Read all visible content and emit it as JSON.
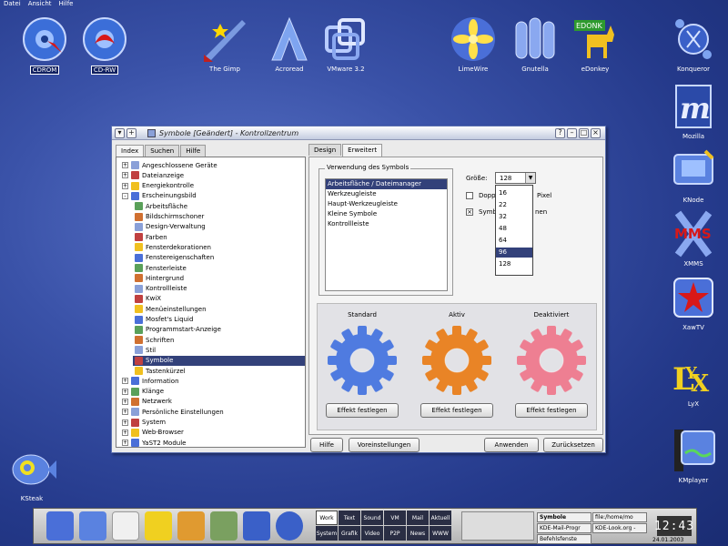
{
  "menubar": [
    "Datei",
    "Ansicht",
    "Hilfe"
  ],
  "desktop_icons": [
    {
      "label": "CDROM",
      "selected": true
    },
    {
      "label": "CD-RW",
      "selected": true
    },
    {
      "label": "The Gimp",
      "selected": false
    },
    {
      "label": "Acroread",
      "selected": false
    },
    {
      "label": "VMware 3.2",
      "selected": false
    },
    {
      "label": "LimeWire",
      "selected": false
    },
    {
      "label": "Gnutella",
      "selected": false
    },
    {
      "label": "eDonkey",
      "selected": false
    },
    {
      "label": "Konqueror",
      "selected": false
    },
    {
      "label": "Mozilla",
      "selected": false
    },
    {
      "label": "KNode",
      "selected": false
    },
    {
      "label": "XMMS",
      "selected": false
    },
    {
      "label": "XawTV",
      "selected": false
    },
    {
      "label": "LyX",
      "selected": false
    },
    {
      "label": "KMplayer",
      "selected": false
    },
    {
      "label": "KSteak",
      "selected": false
    }
  ],
  "window": {
    "title": "Symbole [Geändert] - Kontrollzentrum",
    "left_tabs": [
      "Index",
      "Suchen",
      "Hilfe"
    ],
    "tree": [
      {
        "label": "Angeschlossene Geräte",
        "level": 0,
        "expander": "+"
      },
      {
        "label": "Dateianzeige",
        "level": 0,
        "expander": "+"
      },
      {
        "label": "Energiekontrolle",
        "level": 0,
        "expander": "+"
      },
      {
        "label": "Erscheinungsbild",
        "level": 0,
        "expander": "-"
      },
      {
        "label": "Arbeitsfläche",
        "level": 1,
        "expander": ""
      },
      {
        "label": "Bildschirmschoner",
        "level": 1,
        "expander": ""
      },
      {
        "label": "Design-Verwaltung",
        "level": 1,
        "expander": ""
      },
      {
        "label": "Farben",
        "level": 1,
        "expander": ""
      },
      {
        "label": "Fensterdekorationen",
        "level": 1,
        "expander": ""
      },
      {
        "label": "Fenstereigenschaften",
        "level": 1,
        "expander": ""
      },
      {
        "label": "Fensterleiste",
        "level": 1,
        "expander": ""
      },
      {
        "label": "Hintergrund",
        "level": 1,
        "expander": ""
      },
      {
        "label": "Kontrollleiste",
        "level": 1,
        "expander": ""
      },
      {
        "label": "KwiX",
        "level": 1,
        "expander": ""
      },
      {
        "label": "Menüeinstellungen",
        "level": 1,
        "expander": ""
      },
      {
        "label": "Mosfet's Liquid",
        "level": 1,
        "expander": ""
      },
      {
        "label": "Programmstart-Anzeige",
        "level": 1,
        "expander": ""
      },
      {
        "label": "Schriften",
        "level": 1,
        "expander": ""
      },
      {
        "label": "Stil",
        "level": 1,
        "expander": ""
      },
      {
        "label": "Symbole",
        "level": 1,
        "expander": "",
        "selected": true
      },
      {
        "label": "Tastenkürzel",
        "level": 1,
        "expander": ""
      },
      {
        "label": "Information",
        "level": 0,
        "expander": "+"
      },
      {
        "label": "Klänge",
        "level": 0,
        "expander": "+"
      },
      {
        "label": "Netzwerk",
        "level": 0,
        "expander": "+"
      },
      {
        "label": "Persönliche Einstellungen",
        "level": 0,
        "expander": "+"
      },
      {
        "label": "System",
        "level": 0,
        "expander": "+"
      },
      {
        "label": "Web-Browser",
        "level": 0,
        "expander": "+"
      },
      {
        "label": "YaST2 Module",
        "level": 0,
        "expander": "+"
      }
    ],
    "right_tabs": [
      "Design",
      "Erweitert"
    ],
    "usage_group_label": "Verwendung des Symbols",
    "usage_items": [
      "Arbeitsfläche / Dateimanager",
      "Werkzeugleiste",
      "Haupt-Werkzeugleiste",
      "Kleine Symbole",
      "Kontrollleiste"
    ],
    "size_label": "Größe:",
    "size_value": "128",
    "size_options": [
      "16",
      "22",
      "32",
      "48",
      "64",
      "96",
      "128"
    ],
    "size_highlighted": "96",
    "checkbox1_label_tail": "Pixel",
    "checkbox1_label_head": "Dopp",
    "checkbox2_label_head": "Symb",
    "checkbox2_label_tail": "nen",
    "states": [
      {
        "label": "Standard",
        "button": "Effekt festlegen",
        "color": "#4f7be0"
      },
      {
        "label": "Aktiv",
        "button": "Effekt festlegen",
        "color": "#e98426"
      },
      {
        "label": "Deaktiviert",
        "button": "Effekt festlegen",
        "color": "#ee7f92"
      }
    ],
    "buttons": {
      "help": "Hilfe",
      "defaults": "Voreinstellungen",
      "apply": "Anwenden",
      "reset": "Zurücksetzen"
    }
  },
  "taskbar": {
    "pager": [
      "Work",
      "Text",
      "Sound",
      "VM",
      "Mail",
      "Aktuell",
      "System",
      "Grafik",
      "Video",
      "P2P",
      "News",
      "WWW"
    ],
    "tasks": [
      "Symbole",
      "KDE-Mail-Progr",
      "Befehlsfenste",
      "file:/home/mo",
      "KDE-Look.org -"
    ],
    "clock_time": "12:43",
    "clock_date": "24.01.2003"
  }
}
